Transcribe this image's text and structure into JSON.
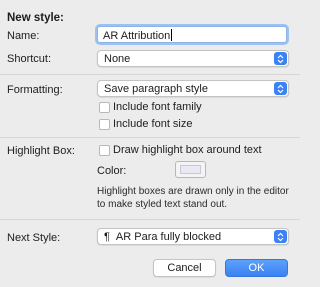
{
  "dialog": {
    "title": "New style:"
  },
  "name": {
    "label": "Name:",
    "value": "AR Attribution"
  },
  "shortcut": {
    "label": "Shortcut:",
    "value": "None"
  },
  "formatting": {
    "label": "Formatting:",
    "value": "Save paragraph style",
    "include_font_family": "Include font family",
    "include_font_size": "Include font size"
  },
  "highlight": {
    "label": "Highlight Box:",
    "draw_label": "Draw highlight box around text",
    "color_label": "Color:",
    "color": "#ebe8f5",
    "note": "Highlight boxes are drawn only in the editor to make styled text stand out."
  },
  "next_style": {
    "label": "Next Style:",
    "icon": "pilcrow-icon",
    "value": "AR Para fully blocked"
  },
  "buttons": {
    "cancel": "Cancel",
    "ok": "OK"
  },
  "colors": {
    "accent": "#3b82f6"
  }
}
